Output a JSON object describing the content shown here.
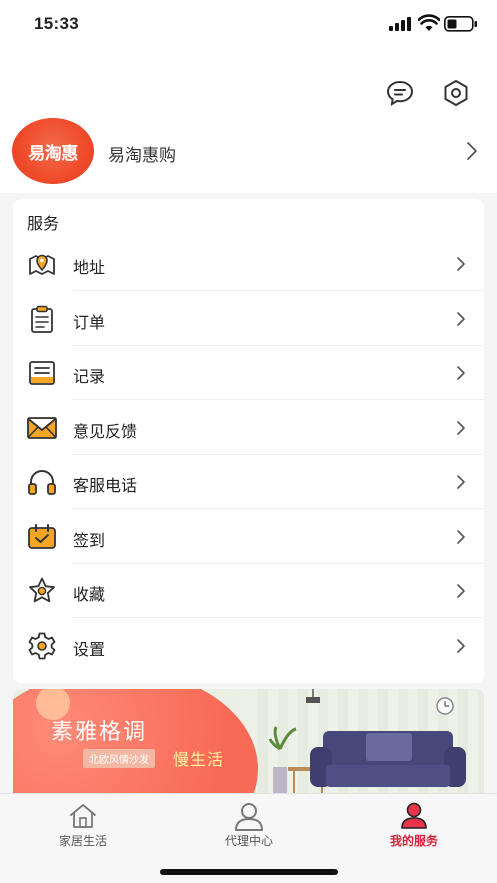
{
  "status": {
    "time": "15:33"
  },
  "header": {
    "avatar_text": "易淘惠",
    "username": "易淘惠购",
    "icons": [
      "message-icon",
      "settings-hex-icon"
    ]
  },
  "services": {
    "title": "服务",
    "items": [
      {
        "label": "地址",
        "icon": "map-pin-icon"
      },
      {
        "label": "订单",
        "icon": "clipboard-icon"
      },
      {
        "label": "记录",
        "icon": "record-icon"
      },
      {
        "label": "意见反馈",
        "icon": "envelope-icon"
      },
      {
        "label": "客服电话",
        "icon": "headphones-icon"
      },
      {
        "label": "签到",
        "icon": "calendar-check-icon"
      },
      {
        "label": "收藏",
        "icon": "star-icon"
      },
      {
        "label": "设置",
        "icon": "gear-icon"
      }
    ]
  },
  "banner": {
    "title": "素雅格调",
    "tag": "北欧风情沙发",
    "slogan": "慢生活"
  },
  "tabbar": {
    "tabs": [
      {
        "label": "家居生活",
        "icon": "home-icon"
      },
      {
        "label": "代理中心",
        "icon": "person-icon"
      },
      {
        "label": "我的服务",
        "icon": "person-active-icon"
      }
    ],
    "active_color": "#d9213a"
  }
}
